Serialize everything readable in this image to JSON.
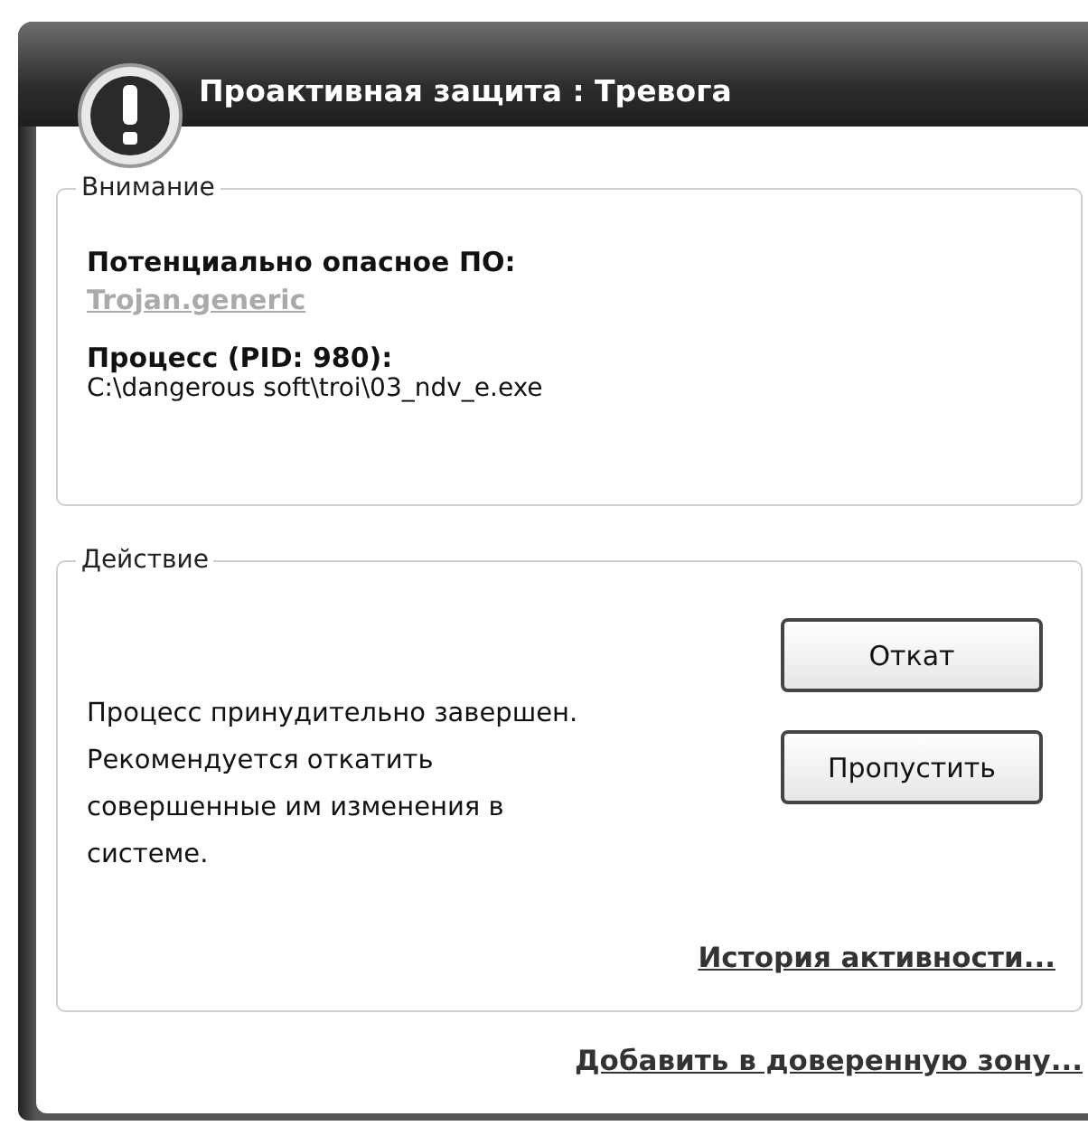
{
  "window": {
    "title": "Проактивная защита : Тревога"
  },
  "attention": {
    "legend": "Внимание",
    "threat_label": "Потенциально опасное ПО:",
    "threat_name": "Trojan.generic",
    "process_label": "Процесс (PID: 980):",
    "process_path": "C:\\dangerous soft\\troi\\03_ndv_e.exe"
  },
  "action": {
    "legend": "Действие",
    "message": "Процесс принудительно завершен. Рекомендуется откатить совершенные им изменения в системе.",
    "buttons": [
      "Откат",
      "Пропустить"
    ],
    "history_link": "История активности..."
  },
  "trust_link": "Добавить в доверенную зону..."
}
